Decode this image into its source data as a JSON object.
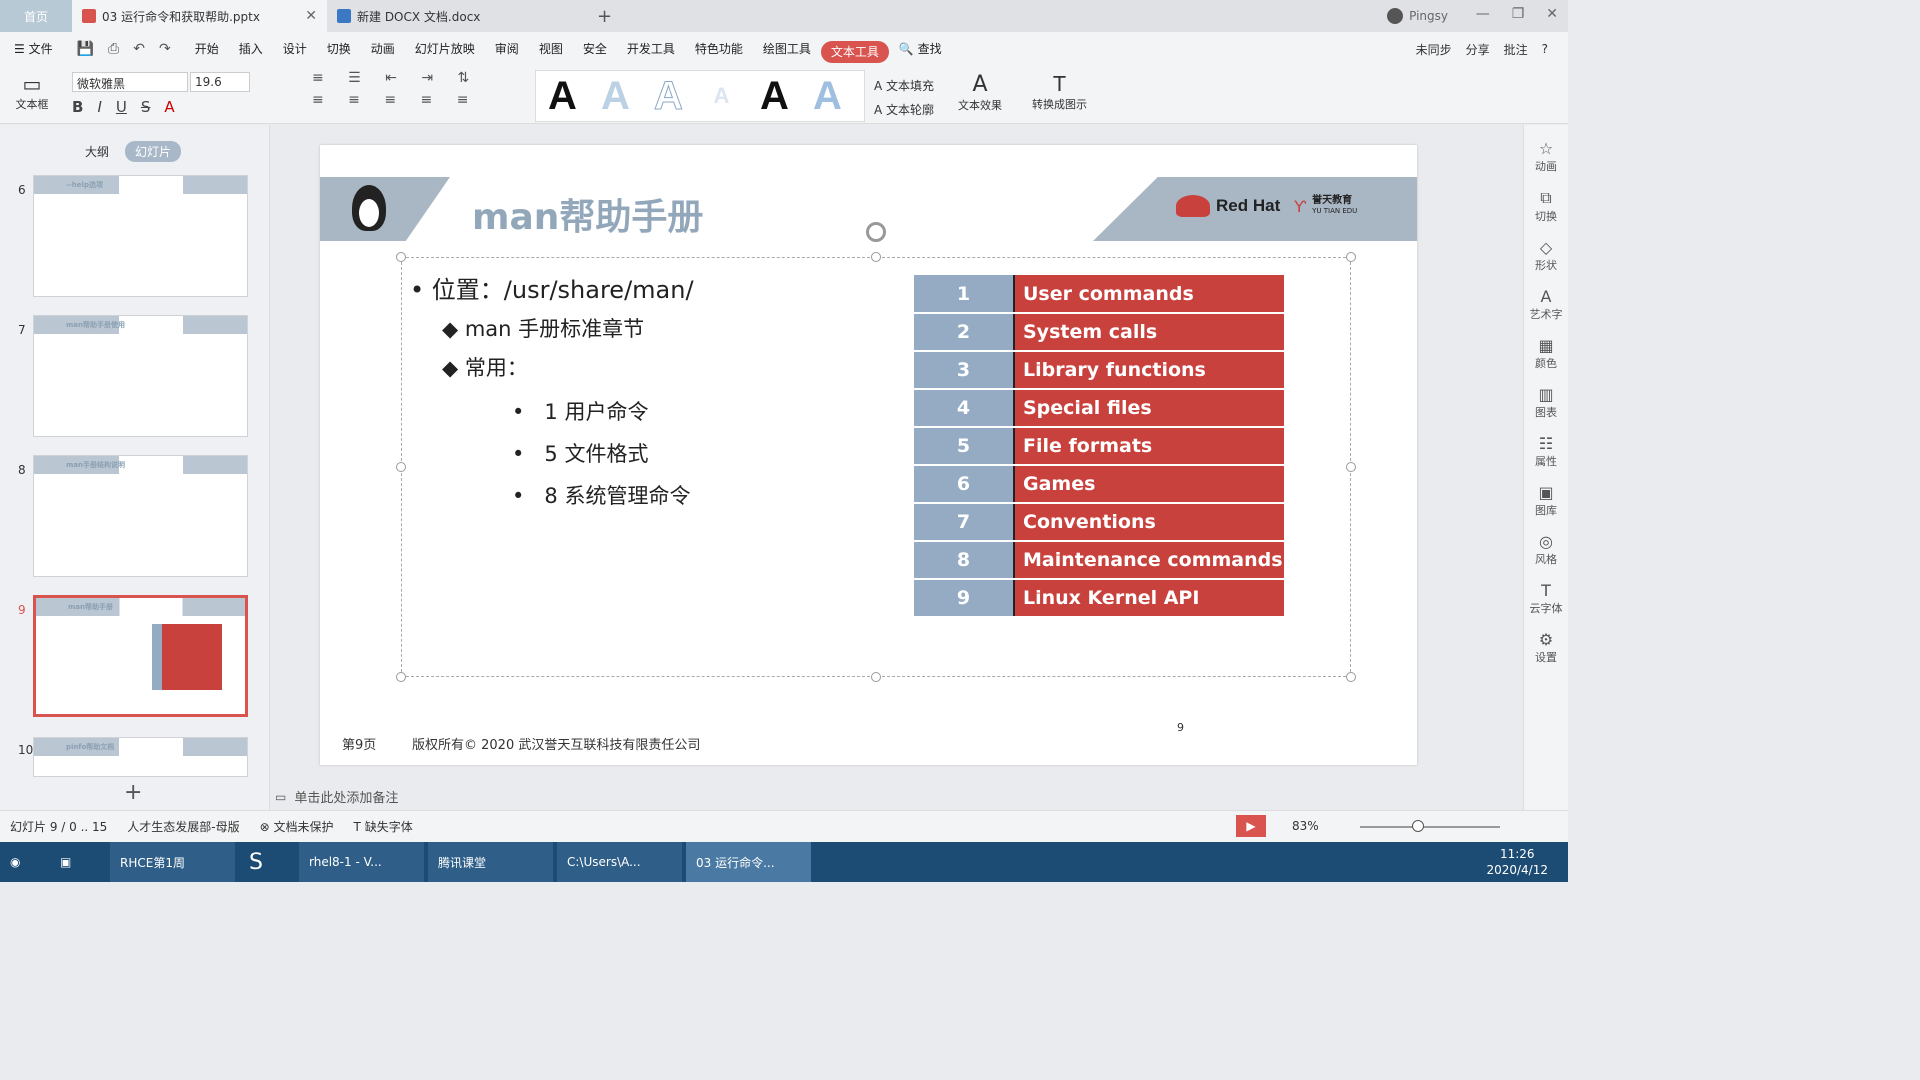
{
  "titlebar": {
    "home": "首页",
    "tabs": [
      {
        "label": "03 运行命令和获取帮助.pptx"
      },
      {
        "label": "新建 DOCX 文档.docx"
      }
    ],
    "user": "Pingsy",
    "new_tab": "+"
  },
  "menubar": {
    "file": "文件",
    "items": [
      "开始",
      "插入",
      "设计",
      "切换",
      "动画",
      "幻灯片放映",
      "审阅",
      "视图",
      "安全",
      "开发工具",
      "特色功能",
      "绘图工具",
      "文本工具"
    ],
    "search": "查找",
    "sync": "未同步",
    "share": "分享",
    "comment": "批注"
  },
  "ribbon": {
    "textbox": "文本框",
    "font": "微软雅黑",
    "size": "19.6",
    "fill": "文本填充",
    "outline": "文本轮廓",
    "effect": "文本效果",
    "convert": "转换成图示"
  },
  "leftpanel": {
    "tab_outline": "大纲",
    "tab_slides": "幻灯片",
    "slides": [
      {
        "num": "6",
        "title": "--help选项"
      },
      {
        "num": "7",
        "title": "man帮助手册使用"
      },
      {
        "num": "8",
        "title": "man手册结构说明"
      },
      {
        "num": "9",
        "title": "man帮助手册"
      },
      {
        "num": "10",
        "title": "pinfo帮助文档"
      }
    ],
    "add": "+"
  },
  "slide": {
    "title": "man帮助手册",
    "brand": "Red Hat",
    "brand2": "誉天教育",
    "brand3": "YU TIAN EDU",
    "bullet1": "位置：/usr/share/man/",
    "sub1": "man 手册标准章节",
    "sub2": "常用：",
    "items": [
      "1  用户命令",
      "5  文件格式",
      "8 系统管理命令"
    ],
    "table": [
      {
        "n": "1",
        "t": "User commands"
      },
      {
        "n": "2",
        "t": "System calls"
      },
      {
        "n": "3",
        "t": "Library functions"
      },
      {
        "n": "4",
        "t": "Special files"
      },
      {
        "n": "5",
        "t": "File formats"
      },
      {
        "n": "6",
        "t": "Games"
      },
      {
        "n": "7",
        "t": "Conventions"
      },
      {
        "n": "8",
        "t": "Maintenance commands"
      },
      {
        "n": "9",
        "t": "Linux  Kernel API"
      }
    ],
    "footer_page": "第9页",
    "footer_copy": "版权所有© 2020 武汉誉天互联科技有限责任公司",
    "page_num": "9"
  },
  "rightbar": [
    "动画",
    "切换",
    "形状",
    "艺术字",
    "颜色",
    "图表",
    "属性",
    "图库",
    "风格",
    "云字体",
    "设置"
  ],
  "notes": "单击此处添加备注",
  "status": {
    "slide": "幻灯片 9 / 0 .. 15",
    "template": "人才生态发展部-母版",
    "protect": "文档未保护",
    "font_missing": "缺失字体",
    "zoom": "83%"
  },
  "taskbar": {
    "apps": [
      "RHCE第1周",
      "rhel8-1 - V...",
      "腾讯课堂",
      "C:\\Users\\A...",
      "03 运行命令..."
    ],
    "time": "11:26",
    "date": "2020/4/12"
  },
  "colors": {
    "accent": "#d9534f",
    "table_num": "#94abc3",
    "table_text": "#c9413d"
  }
}
